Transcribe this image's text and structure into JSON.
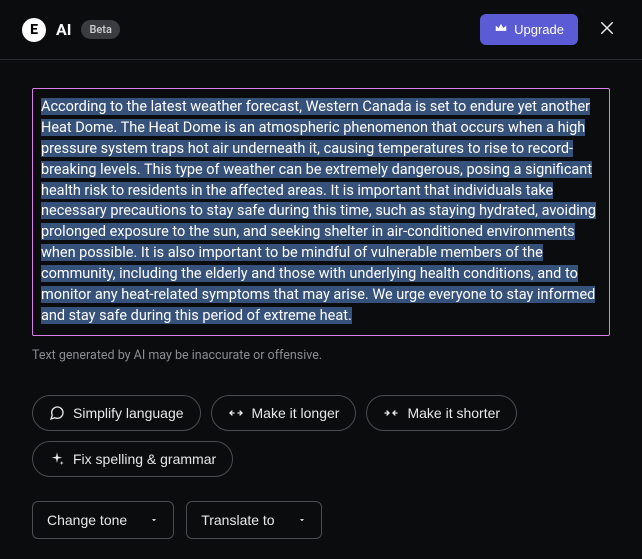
{
  "header": {
    "logo_letter": "E",
    "ai_label": "AI",
    "beta_label": "Beta",
    "upgrade_label": "Upgrade"
  },
  "main": {
    "generated_text": "According to the latest weather forecast, Western Canada is set to endure yet another Heat Dome. The Heat Dome is an atmospheric phenomenon that occurs when a high pressure system traps hot air underneath it, causing temperatures to rise to record-breaking levels. This type of weather can be extremely dangerous, posing a significant health risk to residents in the affected areas. It is important that individuals take necessary precautions to stay safe during this time, such as staying hydrated, avoiding prolonged exposure to the sun, and seeking shelter in air-conditioned environments when possible. It is also important to be mindful of vulnerable members of the community, including the elderly and those with underlying health conditions, and to monitor any heat-related symptoms that may arise. We urge everyone to stay informed and stay safe during this period of extreme heat.",
    "disclaimer": "Text generated by AI may be inaccurate or offensive."
  },
  "actions": {
    "simplify": "Simplify language",
    "longer": "Make it longer",
    "shorter": "Make it shorter",
    "spelling": "Fix spelling & grammar"
  },
  "dropdowns": {
    "tone": "Change tone",
    "translate": "Translate to"
  }
}
